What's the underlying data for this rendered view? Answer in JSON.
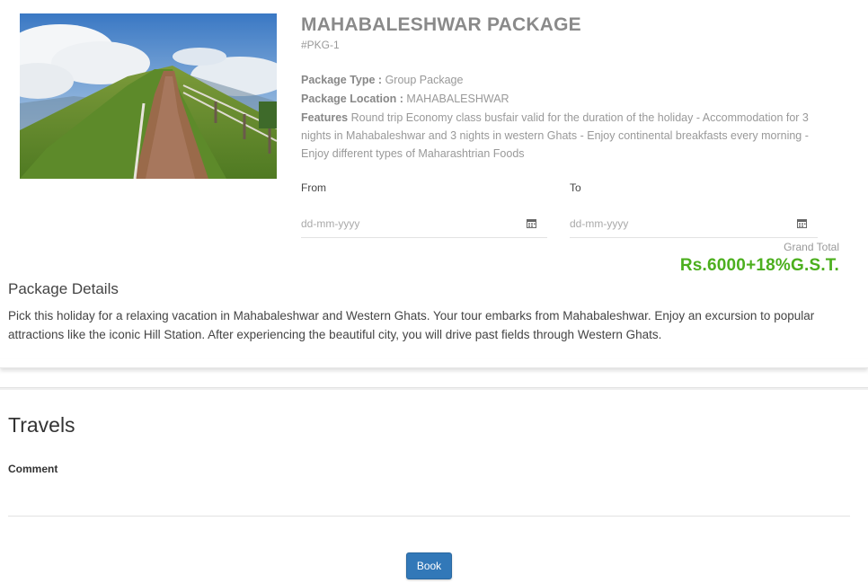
{
  "package": {
    "title": "MAHABALESHWAR PACKAGE",
    "code": "#PKG-1",
    "type_label": "Package Type :",
    "type_value": "Group Package",
    "location_label": "Package Location :",
    "location_value": "MAHABALESHWAR",
    "features_label": "Features",
    "features_value": "Round trip Economy class busfair valid for the duration of the holiday - Accommodation for 3 nights in Mahabaleshwar and 3 nights in western Ghats - Enjoy continental breakfasts every morning - Enjoy different types of Maharashtrian Foods"
  },
  "booking": {
    "from_label": "From",
    "from_placeholder": "dd-mm-yyyy",
    "to_label": "To",
    "to_placeholder": "dd-mm-yyyy",
    "grand_total_label": "Grand Total",
    "grand_total_value": "Rs.6000+18%G.S.T."
  },
  "details": {
    "title": "Package Details",
    "text": "Pick this holiday for a relaxing vacation in Mahabaleshwar and Western Ghats. Your tour embarks from Mahabaleshwar. Enjoy an excursion to popular attractions like the iconic Hill Station. After experiencing the beautiful city, you will drive past fields through Western Ghats."
  },
  "travels": {
    "title": "Travels",
    "comment_label": "Comment",
    "book_label": "Book"
  },
  "icons": {
    "calendar": "calendar-icon"
  },
  "colors": {
    "grand_total": "#4caf1e",
    "book_button": "#3278b8"
  }
}
